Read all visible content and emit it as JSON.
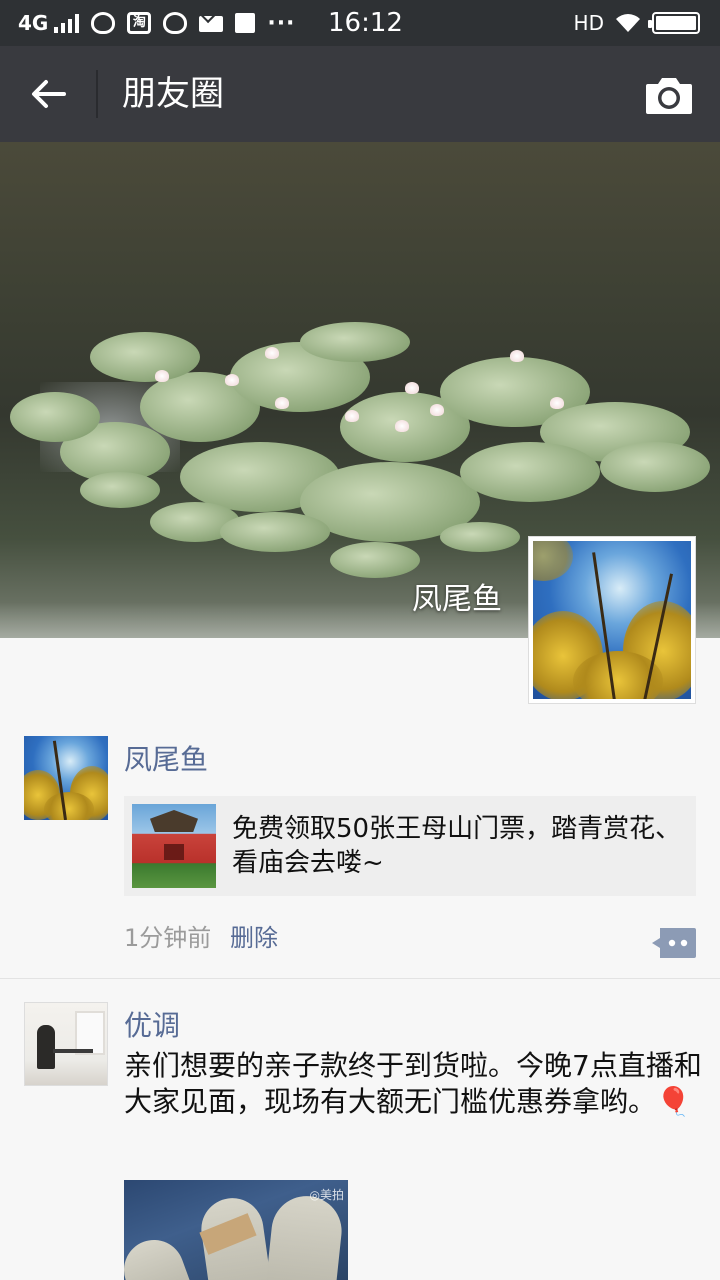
{
  "status_bar": {
    "network": "4G",
    "time": "16:12",
    "hd": "HD",
    "dots": "···"
  },
  "header": {
    "title": "朋友圈"
  },
  "cover": {
    "user_name": "凤尾鱼"
  },
  "posts": [
    {
      "name": "凤尾鱼",
      "link_text": "免费领取50张王母山门票，踏青赏花、看庙会去喽~",
      "time": "1分钟前",
      "delete_label": "删除"
    },
    {
      "name": "优调",
      "text": "亲们想要的亲子款终于到货啦。今晚7点直播和大家见面，现场有大额无门槛优惠券拿哟。🎈",
      "image_watermark": "◎美拍"
    }
  ],
  "colors": {
    "status_bar": "#2e3134",
    "title_bar": "#393a3f",
    "link_name": "#576b95",
    "meta": "#9b9b9b",
    "background": "#f7f7f7"
  }
}
